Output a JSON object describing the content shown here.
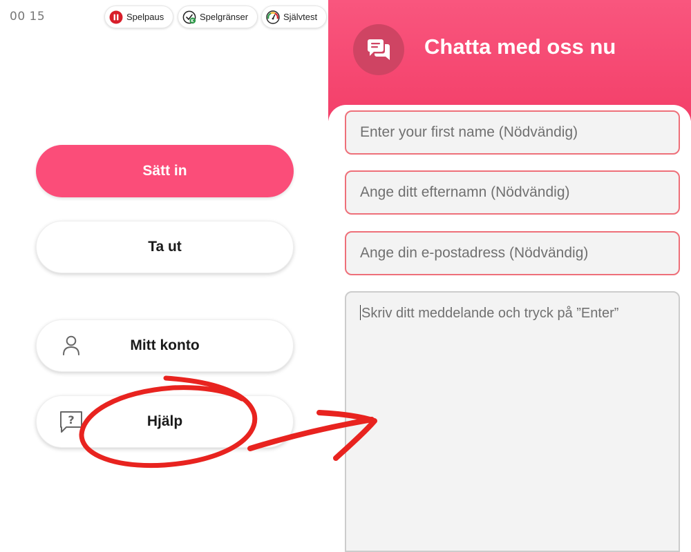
{
  "status": {
    "clock": "00 15"
  },
  "chips": [
    {
      "label": "Spelpaus",
      "icon": "pause-icon",
      "color": "#d81e2a"
    },
    {
      "label": "Spelgränser",
      "icon": "limits-icon",
      "color": "#2e9a4a"
    },
    {
      "label": "Självtest",
      "icon": "gauge-icon",
      "color": "#f2b01e"
    }
  ],
  "menu": {
    "deposit": "Sätt in",
    "withdraw": "Ta ut",
    "account": {
      "label": "Mitt konto",
      "icon": "user-icon"
    },
    "help": {
      "label": "Hjälp",
      "icon": "help-question-icon"
    }
  },
  "chat": {
    "title": "Chatta med oss nu",
    "icon": "chat-bubbles-icon",
    "fields": {
      "first_name": "Enter your first name (Nödvändig)",
      "last_name": "Ange ditt efternamn (Nödvändig)",
      "email": "Ange din e-postadress (Nödvändig)",
      "message": "Skriv ditt meddelande och tryck på ”Enter”"
    }
  },
  "colors": {
    "brand_pink": "#fb4d79",
    "header_pink": "#f33f69",
    "field_border": "#ee6f79",
    "annotation_red": "#e8231f"
  }
}
